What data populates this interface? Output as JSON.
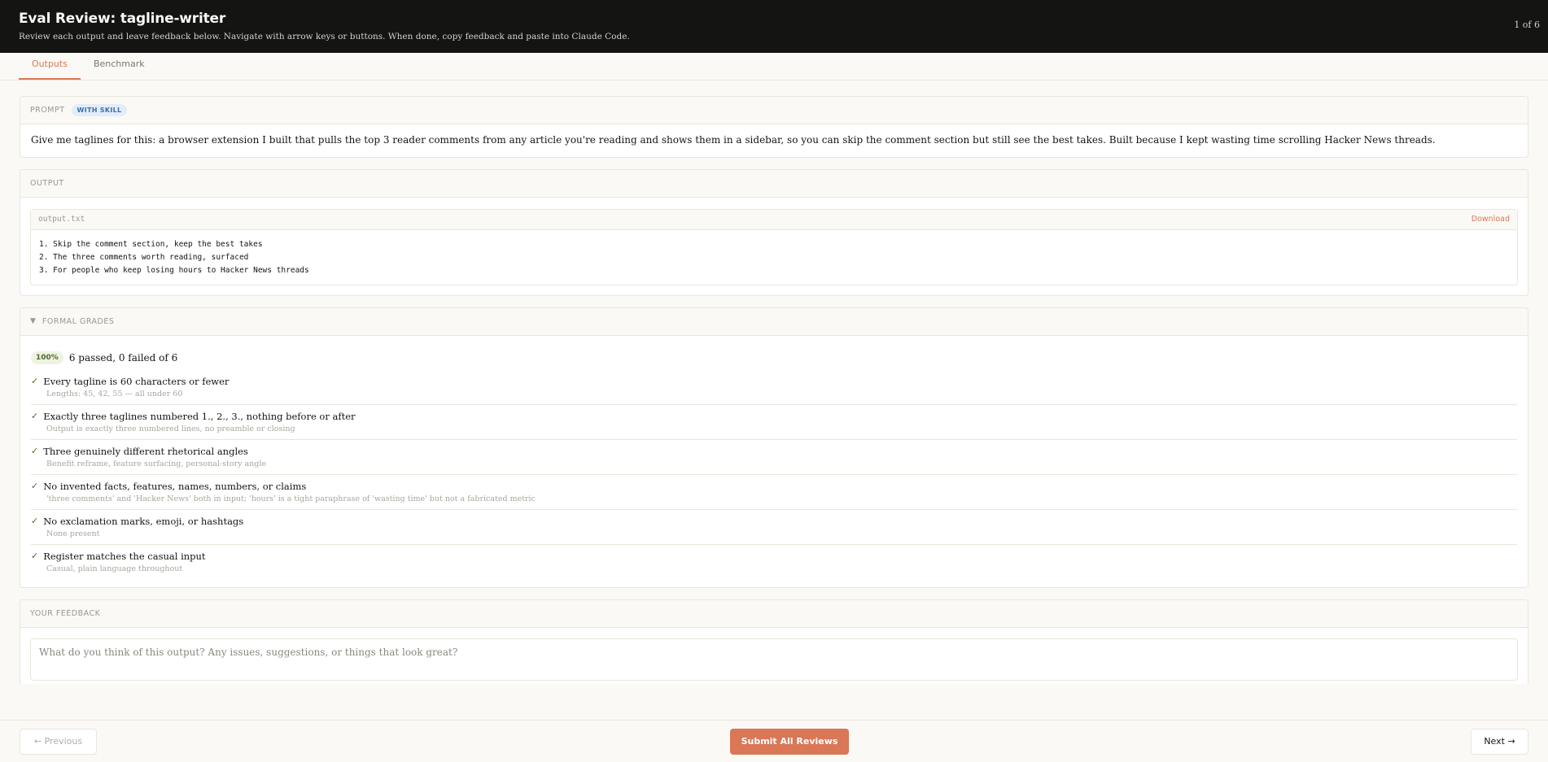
{
  "header": {
    "title": "Eval Review: tagline-writer",
    "subtitle": "Review each output and leave feedback below. Navigate with arrow keys or buttons. When done, copy feedback and paste into Claude Code.",
    "counter": "1 of 6"
  },
  "tabs": [
    {
      "label": "Outputs",
      "active": true
    },
    {
      "label": "Benchmark",
      "active": false
    }
  ],
  "prompt": {
    "label": "PROMPT",
    "badge": "WITH SKILL",
    "text": "Give me taglines for this: a browser extension I built that pulls the top 3 reader comments from any article you're reading and shows them in a sidebar, so you can skip the comment section but still see the best takes. Built because I kept wasting time scrolling Hacker News threads."
  },
  "output": {
    "label": "OUTPUT",
    "file_name": "output.txt",
    "download_label": "Download",
    "content": "1. Skip the comment section, keep the best takes\n2. The three comments worth reading, surfaced\n3. For people who keep losing hours to Hacker News threads"
  },
  "grades": {
    "label": "FORMAL GRADES",
    "caret": "▼",
    "percent": "100%",
    "summary": "6 passed, 0 failed of 6",
    "check_glyph": "✓",
    "items": [
      {
        "title": "Every tagline is 60 characters or fewer",
        "note": "Lengths: 45, 42, 55 — all under 60"
      },
      {
        "title": "Exactly three taglines numbered 1., 2., 3., nothing before or after",
        "note": "Output is exactly three numbered lines, no preamble or closing"
      },
      {
        "title": "Three genuinely different rhetorical angles",
        "note": "Benefit reframe, feature surfacing, personal-story angle"
      },
      {
        "title": "No invented facts, features, names, numbers, or claims",
        "note": "'three comments' and 'Hacker News' both in input; 'hours' is a tight paraphrase of 'wasting time' but not a fabricated metric"
      },
      {
        "title": "No exclamation marks, emoji, or hashtags",
        "note": "None present"
      },
      {
        "title": "Register matches the casual input",
        "note": "Casual, plain language throughout"
      }
    ]
  },
  "feedback": {
    "label": "YOUR FEEDBACK",
    "placeholder": "What do you think of this output? Any issues, suggestions, or things that look great?",
    "value": ""
  },
  "footer": {
    "previous_label": "← Previous",
    "submit_label": "Submit All Reviews",
    "next_label": "Next →"
  },
  "colors": {
    "header_bg": "#141413",
    "accent": "#d97757",
    "pass_green": "#4f6b2f",
    "skill_badge_blue": "#3a6fb0"
  }
}
